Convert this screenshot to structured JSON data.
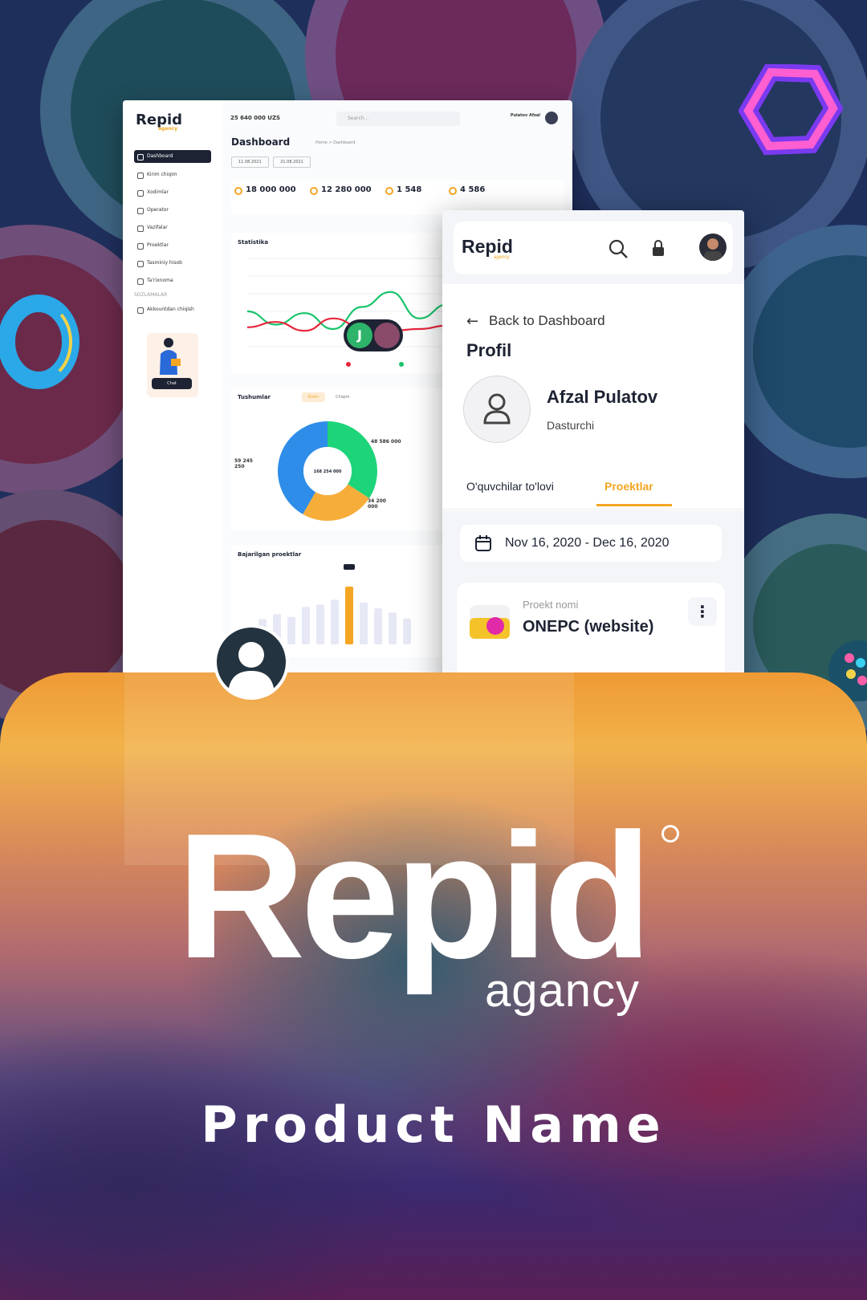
{
  "dashboard": {
    "logo": "Repid",
    "logo_sub": "agency",
    "balance": "25 640 000 UZS",
    "search_placeholder": "Search...",
    "user_name": "Pulatov Afzal",
    "title": "Dashboard",
    "breadcrumb": "Home > Dashboard",
    "date_from": "11.08.2021",
    "date_to": "21.08.2021",
    "nav": [
      {
        "label": "Dashboard",
        "active": true
      },
      {
        "label": "Kirim chiqim"
      },
      {
        "label": "Xodimlar"
      },
      {
        "label": "Operator"
      },
      {
        "label": "Vazifalar"
      },
      {
        "label": "Proektlar"
      },
      {
        "label": "Tasminiy hisob"
      },
      {
        "label": "Ta'rixnoma"
      }
    ],
    "nav_group": "SOZLAMALAR",
    "nav_logout": "Akkountdan chiqish",
    "chat_button": "Chat",
    "stats": [
      "18 000 000",
      "12 280 000",
      "1 548",
      "4 586"
    ],
    "statistics_title": "Statistika",
    "income_title": "Tushumlar",
    "income_tab_on": "Kirim",
    "income_tab_off": "Chiqim",
    "donut_center": "168 254 000",
    "donut_labels": [
      "48 586 000",
      "59 245 250",
      "34 200 000"
    ],
    "projects_title": "Bajarilgan proektlar"
  },
  "chart_data": [
    {
      "type": "line",
      "series": [
        {
          "values": [
            40,
            25,
            38,
            20,
            45,
            62,
            32,
            48
          ]
        },
        {
          "values": [
            22,
            28,
            18,
            32,
            22,
            18,
            20,
            24
          ]
        }
      ],
      "colors": [
        "#18c46b",
        "#e8253a"
      ],
      "ylim": [
        0,
        100
      ]
    },
    {
      "type": "pie",
      "values": [
        48586000,
        34200000,
        59245250
      ],
      "colors": [
        "#1ed47a",
        "#f6ad3a",
        "#2e8de8"
      ]
    },
    {
      "type": "bar",
      "values": [
        35,
        42,
        38,
        52,
        55,
        62,
        80,
        58,
        50,
        44,
        36
      ],
      "highlight": 6
    }
  ],
  "mobile": {
    "logo": "Repid",
    "logo_sub": "agency",
    "back_label": "Back to Dashboard",
    "page_title": "Profil",
    "name": "Afzal Pulatov",
    "role": "Dasturchi",
    "tab_payments": "O'quvchilar to'lovi",
    "tab_projects": "Proektlar",
    "date_range": "Nov 16, 2020 - Dec 16, 2020",
    "project_label": "Proekt nomi",
    "project_name": "ONEPC (website)"
  },
  "badge_letter": "J",
  "brand": {
    "title": "Repid",
    "subtitle": "agancy",
    "product_name": "Product Name"
  },
  "colors": {
    "accent": "#f4a622",
    "dark": "#1d2333",
    "green": "#18c46b",
    "red": "#e8253a"
  }
}
